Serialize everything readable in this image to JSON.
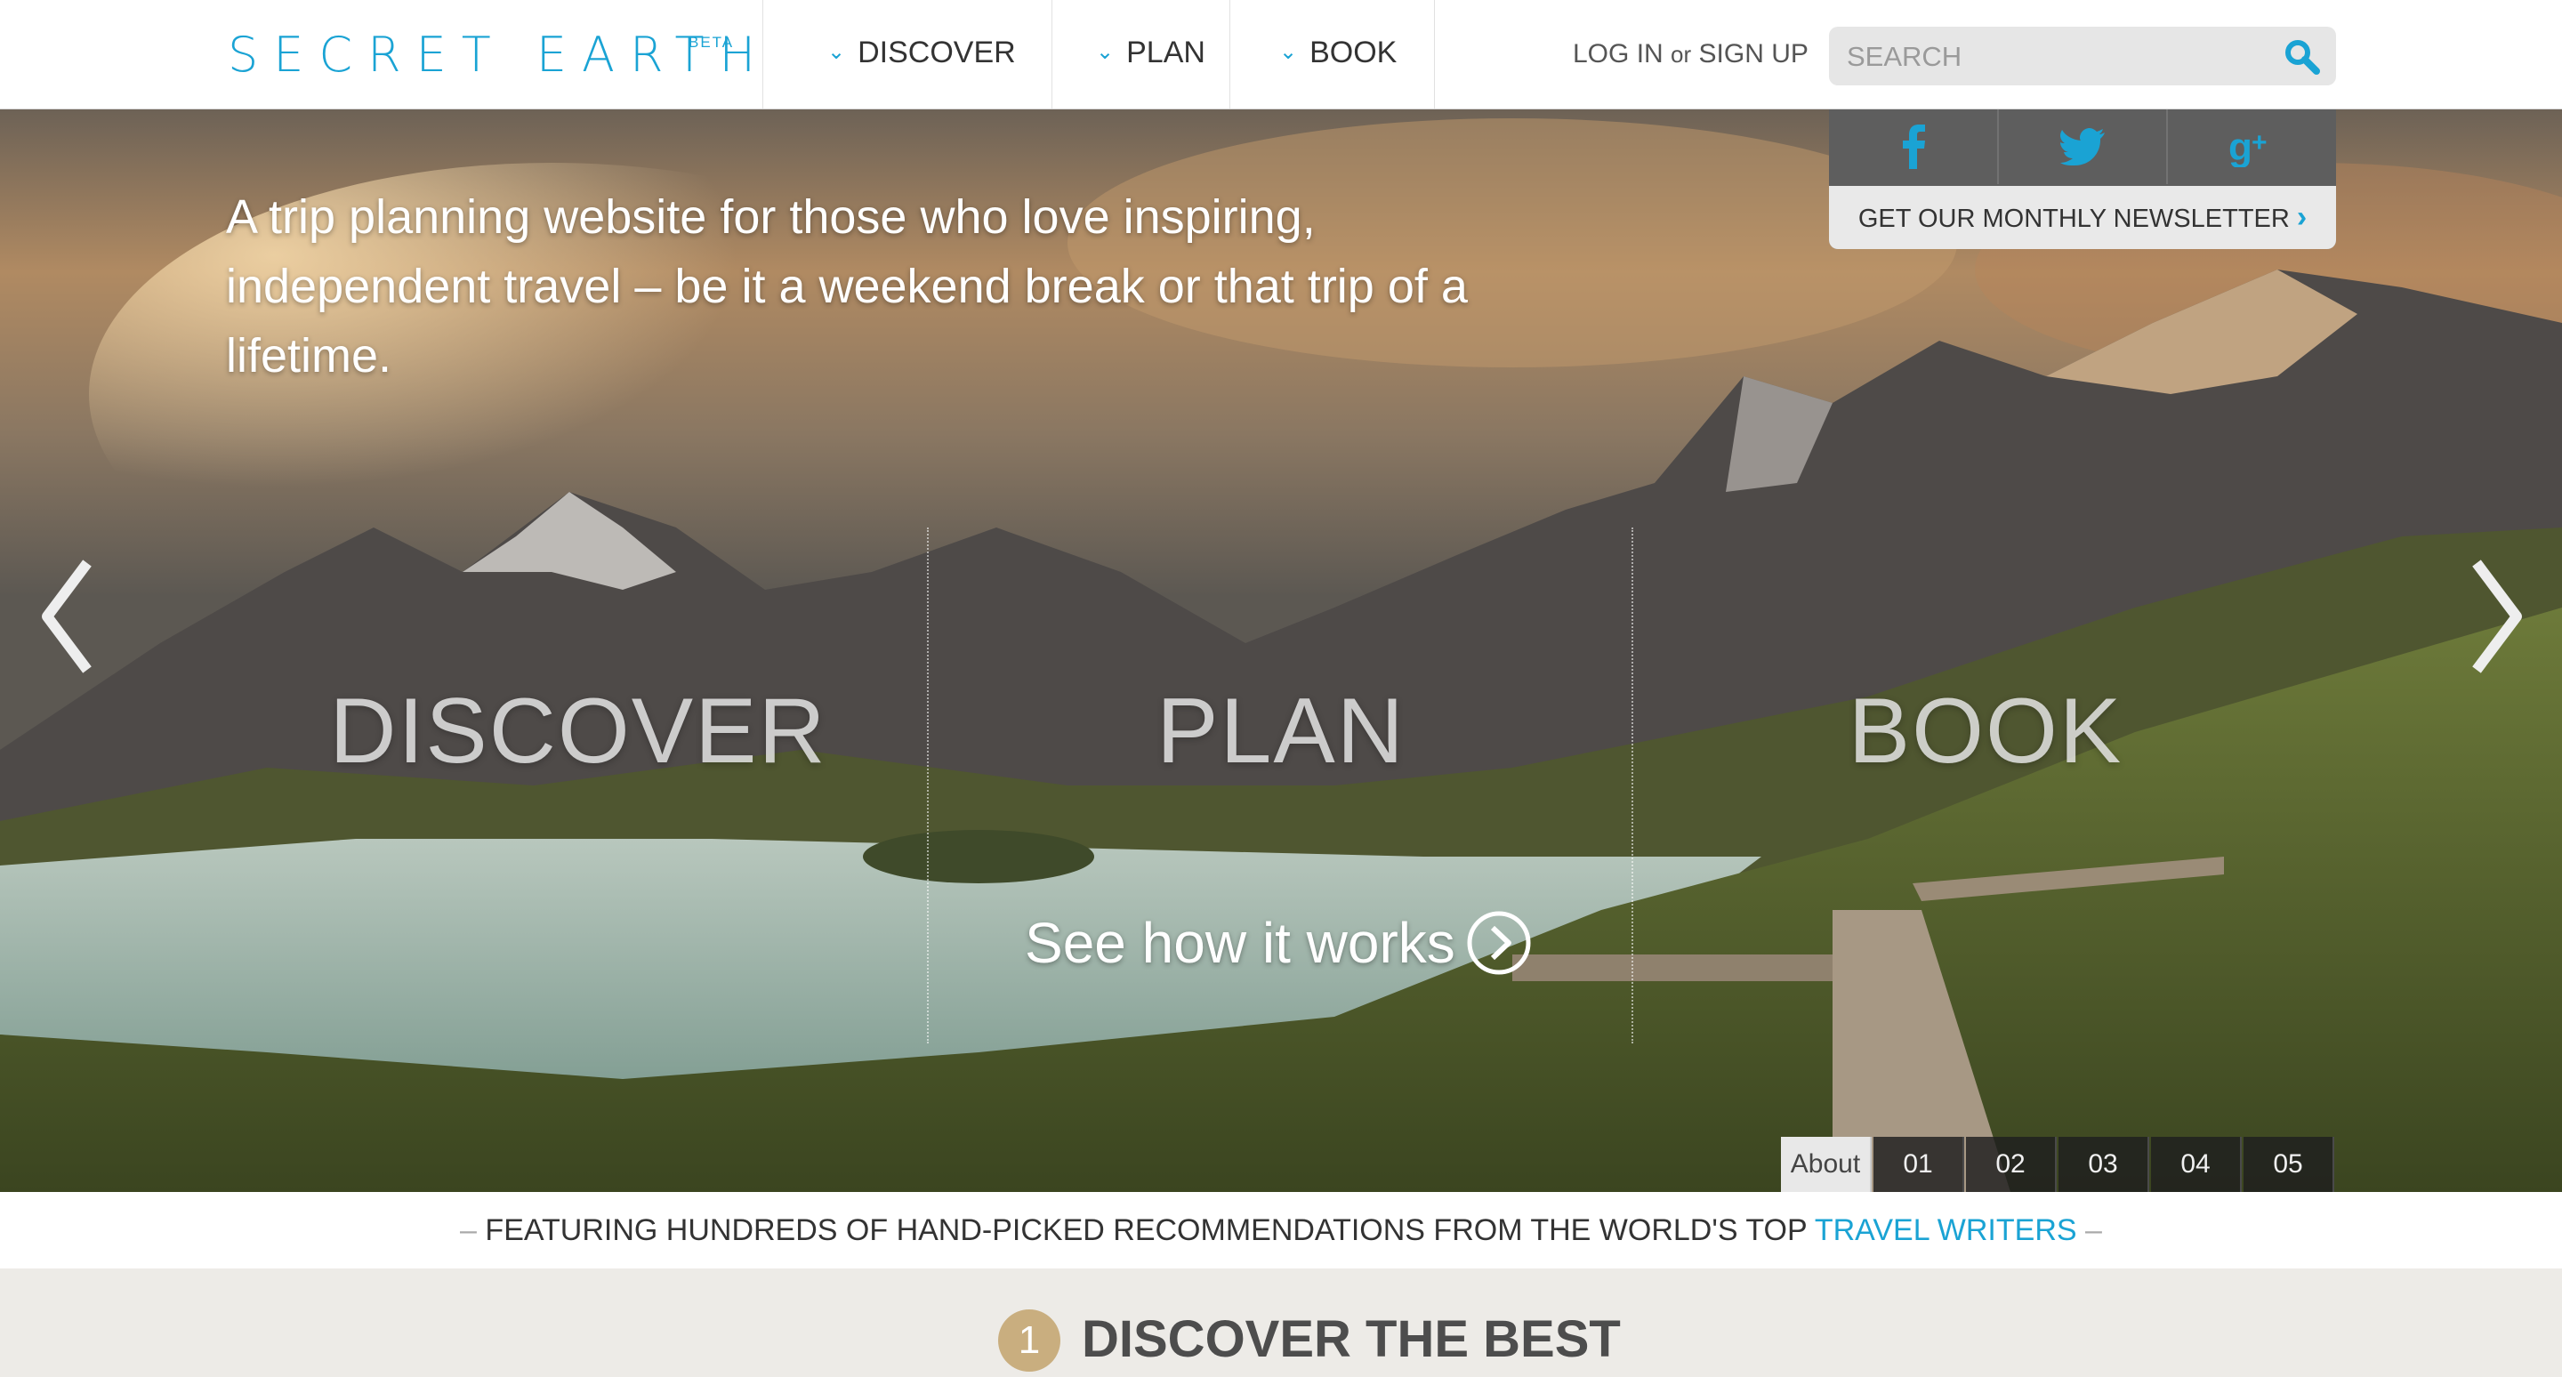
{
  "header": {
    "logo": "SECRET EARTH",
    "logo_badge": "BETA",
    "nav": [
      {
        "label": "DISCOVER"
      },
      {
        "label": "PLAN"
      },
      {
        "label": "BOOK"
      }
    ],
    "login_label": "LOG IN",
    "or_label": "or",
    "signup_label": "SIGN UP",
    "search_placeholder": "SEARCH"
  },
  "social": {
    "icons": [
      "facebook-icon",
      "twitter-icon",
      "google-plus-icon"
    ],
    "newsletter_label": "GET OUR MONTHLY NEWSLETTER"
  },
  "hero": {
    "tagline": "A trip planning website for those who love inspiring, independent travel – be it a weekend break or that trip of a lifetime.",
    "pillars": [
      "DISCOVER",
      "PLAN",
      "BOOK"
    ],
    "cta_label": "See how it works",
    "pager": [
      "About",
      "01",
      "02",
      "03",
      "04",
      "05"
    ]
  },
  "strip": {
    "dash": "–",
    "text": "FEATURING HUNDREDS OF HAND-PICKED RECOMMENDATIONS FROM THE WORLD'S TOP",
    "link": "TRAVEL WRITERS"
  },
  "section": {
    "number": "1",
    "title": "DISCOVER THE BEST"
  },
  "colors": {
    "accent": "#1aa3d4",
    "gold": "#c9ae7f"
  }
}
